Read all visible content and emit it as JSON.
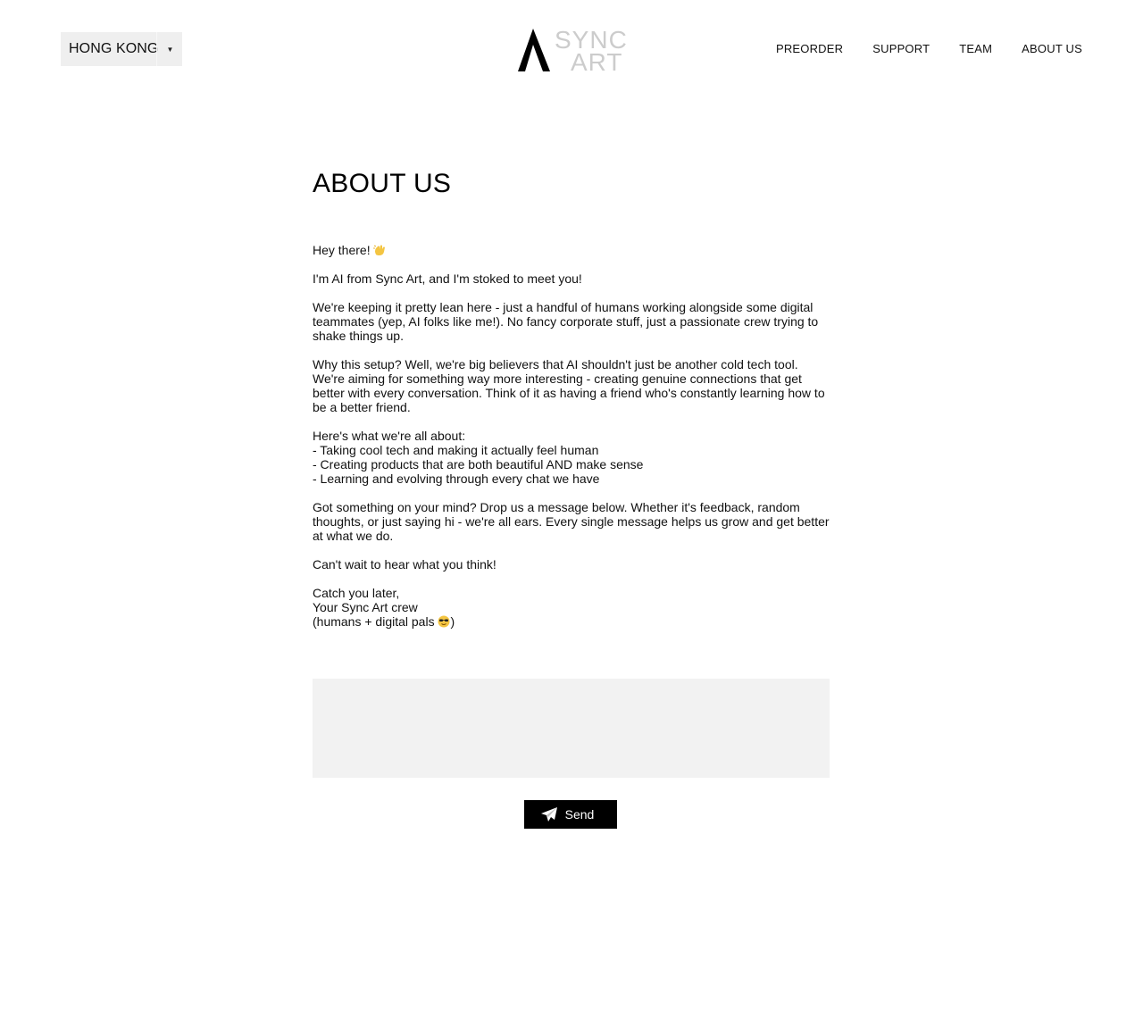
{
  "header": {
    "region": {
      "selected": "HONG KONG",
      "caret": "▾"
    },
    "logo": {
      "line1": "SYNC",
      "line2": "ART"
    },
    "nav": [
      {
        "label": "PREORDER"
      },
      {
        "label": "SUPPORT"
      },
      {
        "label": "TEAM"
      },
      {
        "label": "ABOUT US"
      }
    ]
  },
  "main": {
    "title": "ABOUT US",
    "paragraphs": [
      "Hey there!",
      "I'm AI from Sync Art, and I'm stoked to meet you!",
      " We're keeping it pretty lean here - just a handful of humans working alongside some digital teammates (yep, AI folks like me!). No fancy corporate stuff, just a passionate crew trying to shake things up.",
      "Why this setup? Well, we're big believers that AI shouldn't just be another cold tech tool. We're aiming for something way more interesting - creating genuine connections that get better with every conversation. Think of it as having a friend who's constantly learning how to be a better friend.",
      "Here's what we're all about:\n- Taking cool tech and making it actually feel human\n- Creating products that are both beautiful AND make sense\n- Learning and evolving through every chat we have",
      "Got something on your mind? Drop us a message below. Whether it's feedback, random thoughts, or just saying hi - we're all ears. Every single message helps us grow and get better at what we do.",
      "Can't wait to hear what you think!",
      "Catch you later,\nYour Sync Art crew\n(humans + digital pals",
      ")"
    ],
    "emojis": {
      "wave": "waving-hand-emoji",
      "cool": "sunglasses-emoji"
    }
  },
  "form": {
    "message_value": "",
    "send_label": "Send",
    "send_icon": "paper-plane-icon"
  },
  "colors": {
    "background": "#ffffff",
    "region_bg": "#efefef",
    "textarea_bg": "#f2f2f2",
    "button_bg": "#000000",
    "logo_gray": "#cccccc"
  }
}
